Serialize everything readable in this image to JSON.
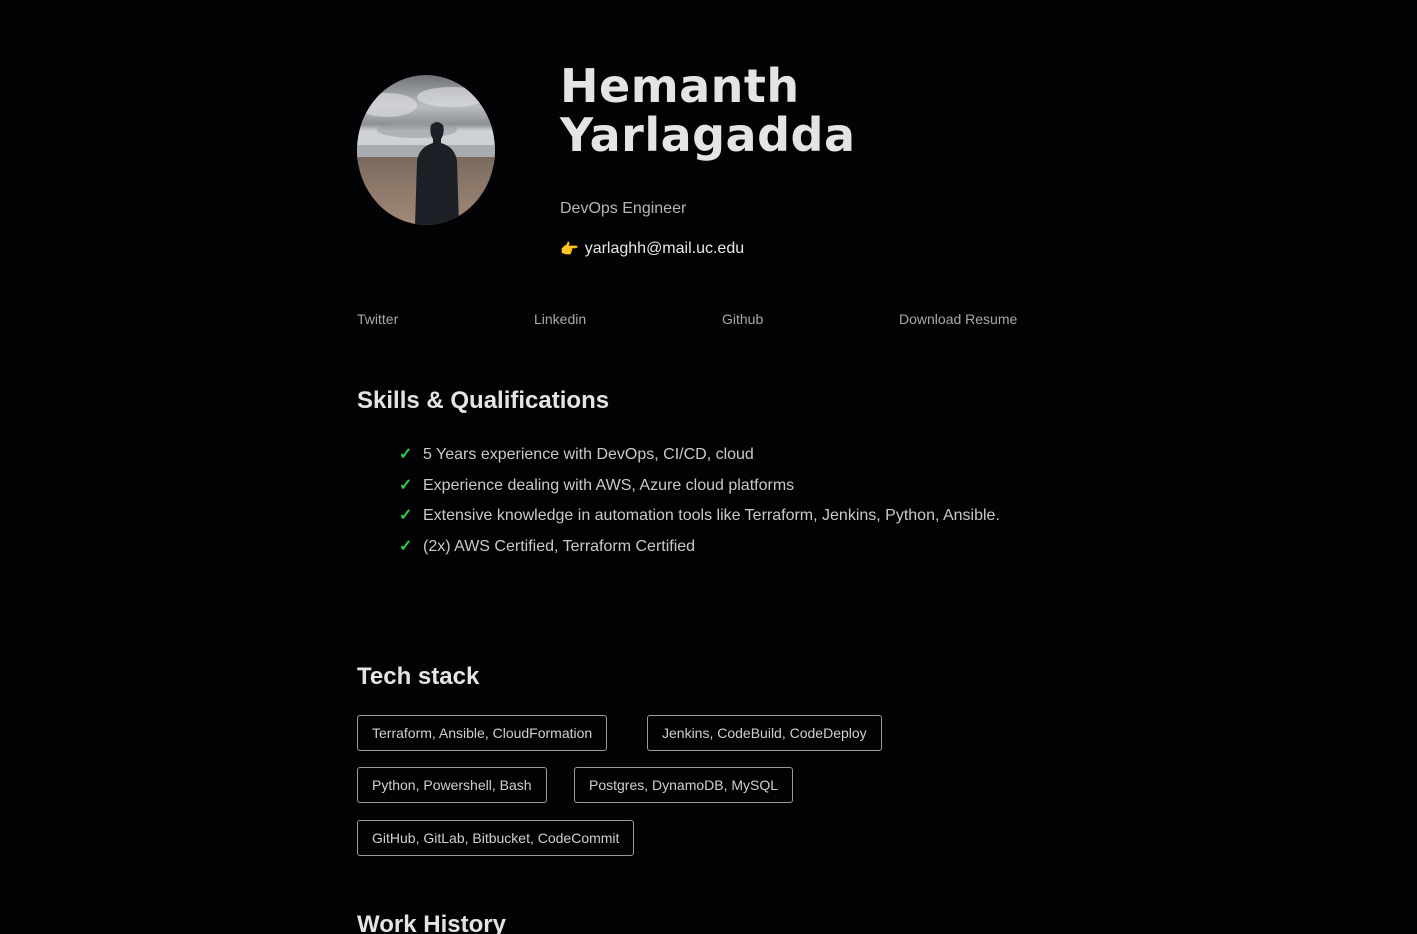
{
  "profile": {
    "name_line1": "Hemanth",
    "name_line2": "Yarlagadda",
    "role": "DevOps Engineer",
    "email_icon": "backhand-index-pointing-right-icon",
    "email": "yarlaghh@mail.uc.edu",
    "avatar_description": "avatar-photo"
  },
  "links": [
    {
      "label": "Twitter"
    },
    {
      "label": "Linkedin"
    },
    {
      "label": "Github"
    },
    {
      "label": "Download Resume"
    }
  ],
  "skills": {
    "title": "Skills & Qualifications",
    "items": [
      "5 Years experience with DevOps, CI/CD, cloud",
      "Experience dealing with AWS, Azure cloud platforms",
      "Extensive knowledge in automation tools like Terraform, Jenkins, Python, Ansible.",
      "(2x) AWS Certified, Terraform Certified"
    ]
  },
  "tech_stack": {
    "title": "Tech stack",
    "chips": [
      "Terraform, Ansible, CloudFormation",
      "Jenkins, CodeBuild, CodeDeploy",
      "Python, Powershell, Bash",
      "Postgres, DynamoDB, MySQL",
      "GitHub, GitLab, Bitbucket, CodeCommit"
    ]
  },
  "work_history": {
    "title": "Work History"
  },
  "colors": {
    "background": "#030305",
    "check": "#2fc84a",
    "text": "#d9d9d9"
  }
}
